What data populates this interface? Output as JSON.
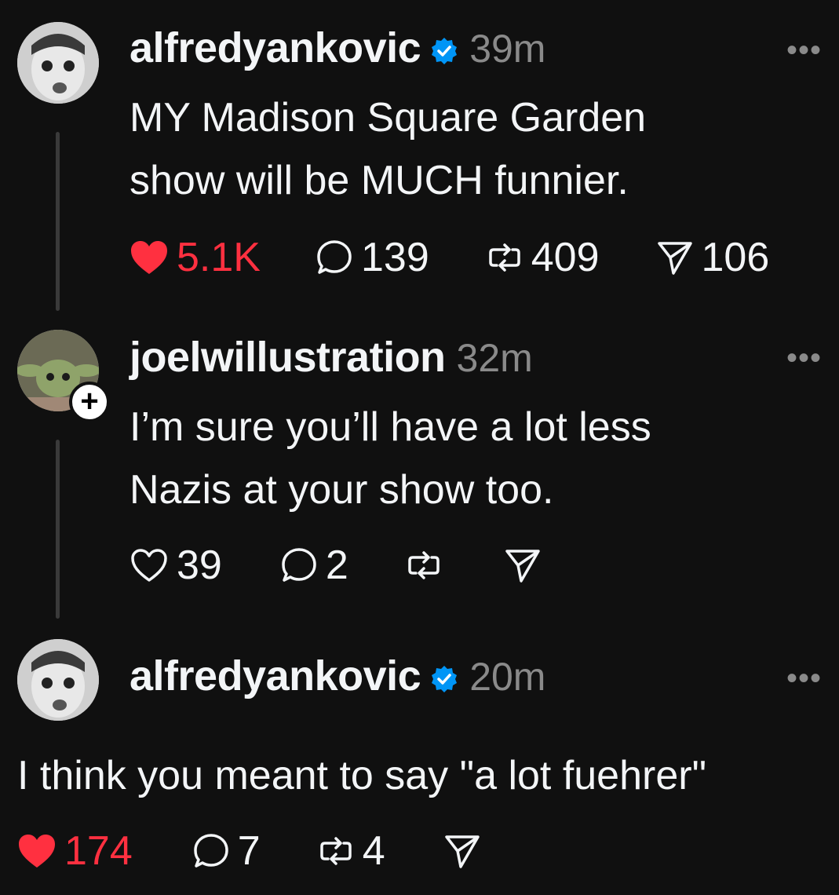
{
  "posts": [
    {
      "username": "alfredyankovic",
      "verified": true,
      "time": "39m",
      "text_lines": [
        "MY Madison Square Garden",
        "show will be MUCH funnier."
      ],
      "likes": "5.1K",
      "liked": true,
      "replies": "139",
      "reposts": "409",
      "shares": "106",
      "more": "•••"
    },
    {
      "username": "joelwillustration",
      "verified": false,
      "time": "32m",
      "text_lines": [
        "I’m sure you’ll have a lot less",
        "Nazis at your show too."
      ],
      "likes": "39",
      "liked": false,
      "replies": "2",
      "reposts": "",
      "shares": "",
      "more": "•••",
      "follow_badge": "+"
    },
    {
      "username": "alfredyankovic",
      "verified": true,
      "time": "20m",
      "text_lines": [
        "I think you meant to say \"a lot fuehrer\""
      ],
      "likes": "174",
      "liked": true,
      "replies": "7",
      "reposts": "4",
      "shares": "",
      "more": "•••"
    }
  ],
  "colors": {
    "background": "#101010",
    "like_red": "#ff3040",
    "verified_blue": "#0095f6",
    "muted": "#8a8a8a"
  }
}
